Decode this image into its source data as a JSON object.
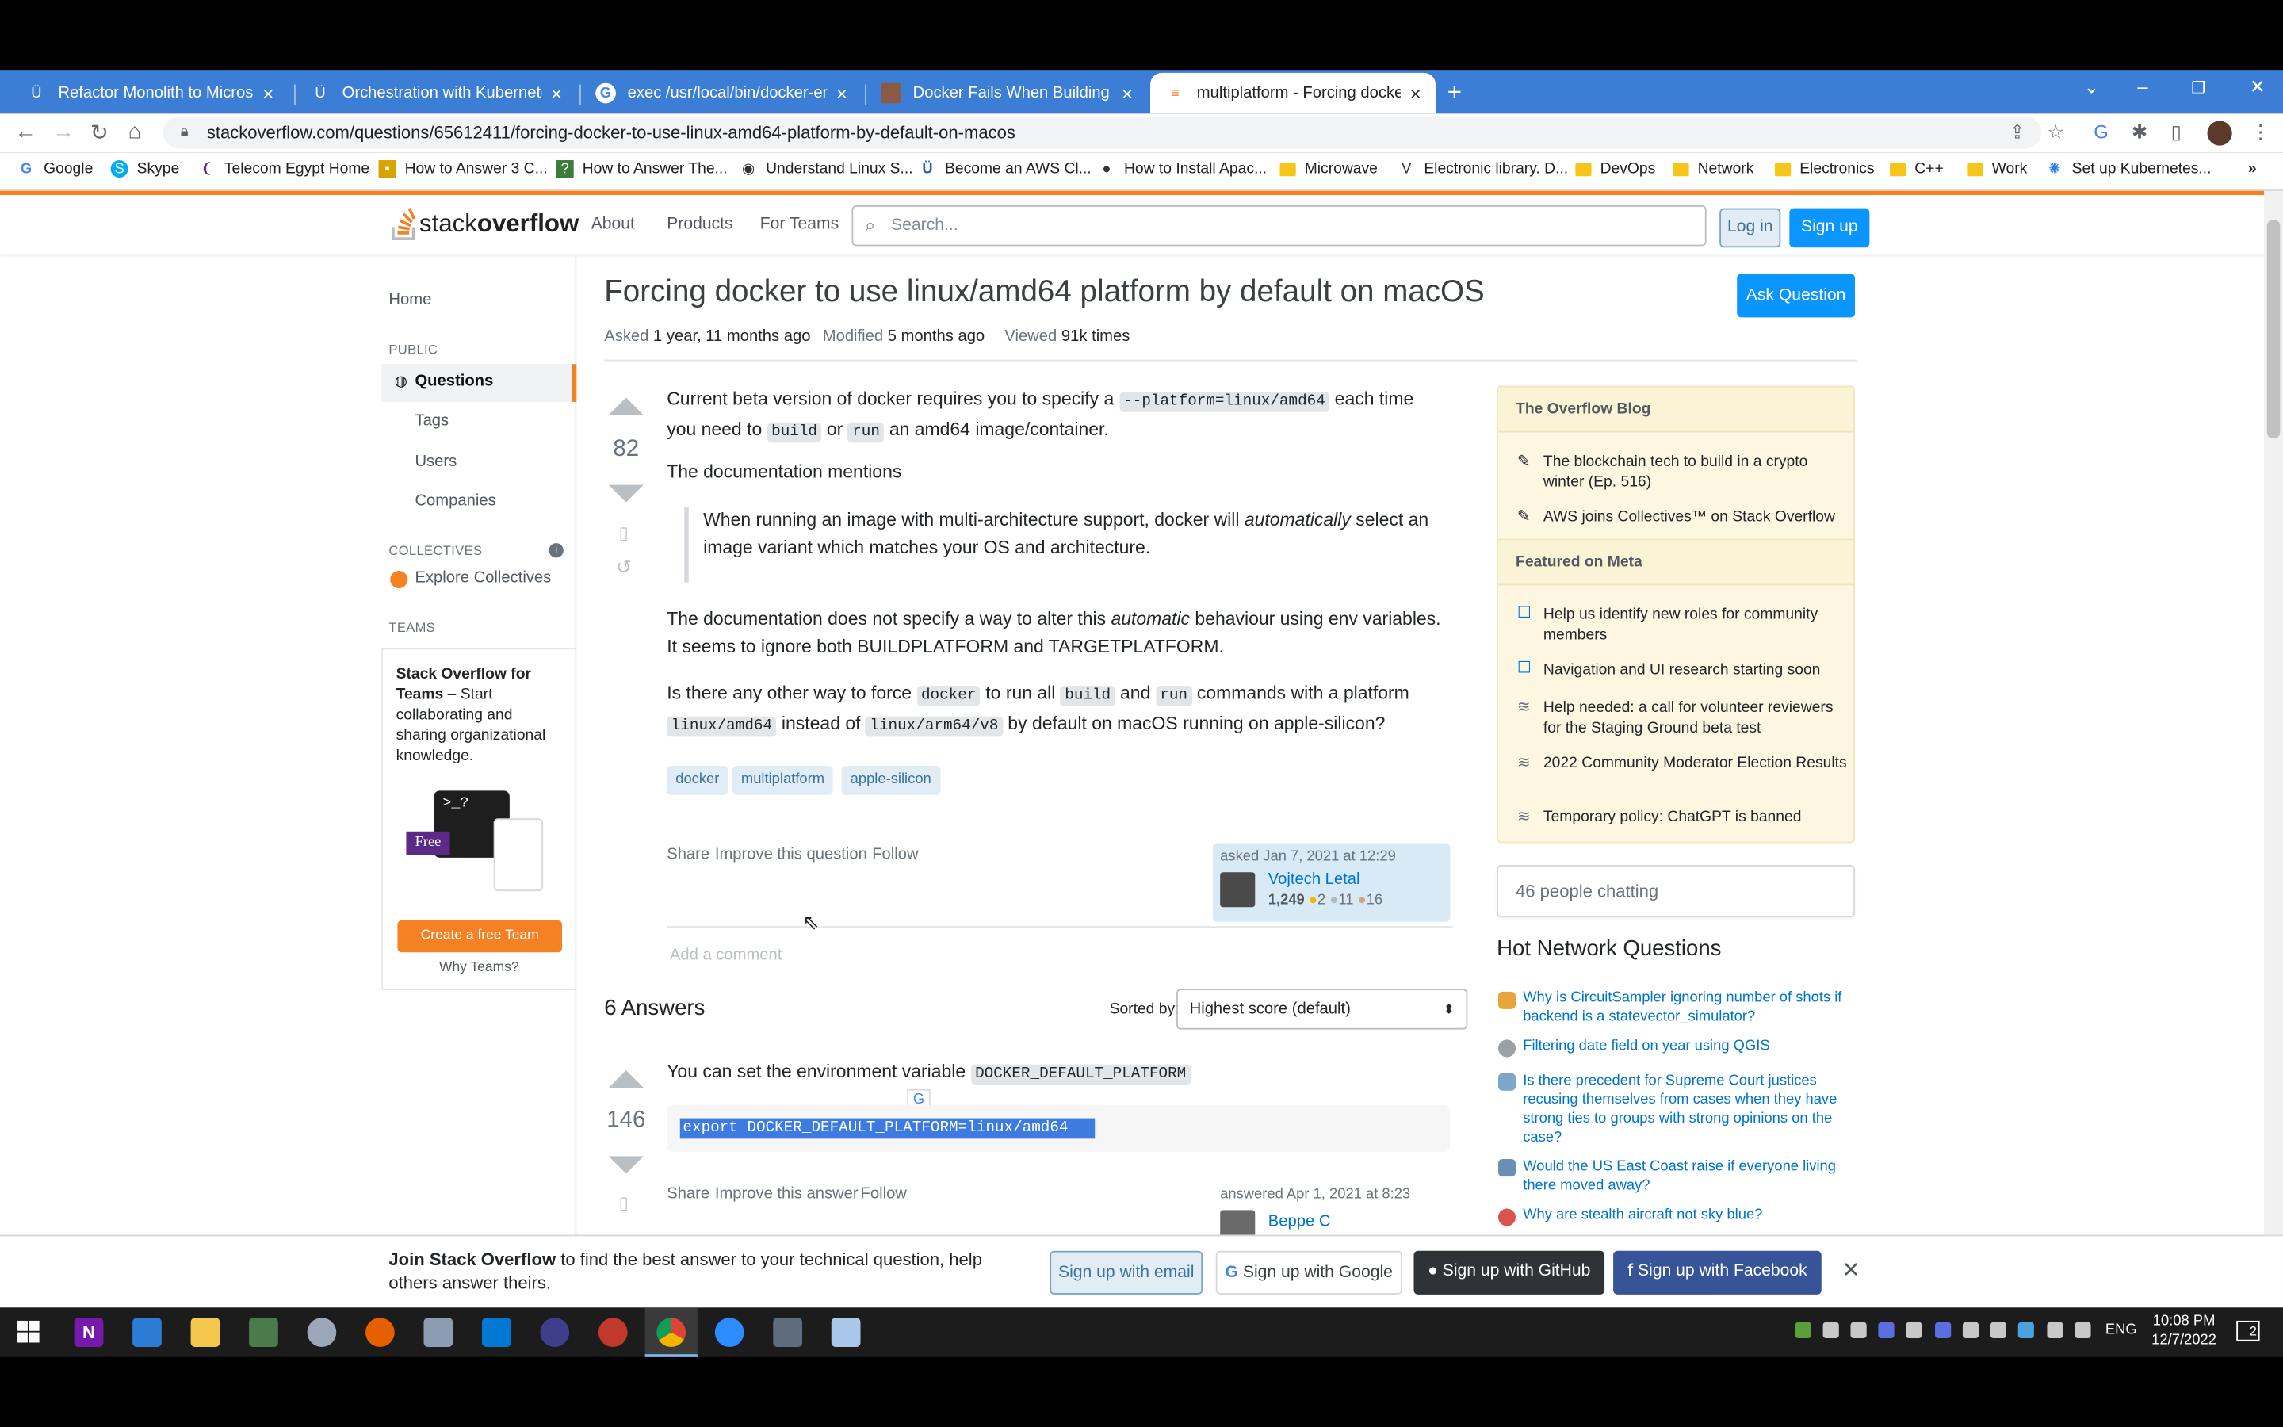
{
  "browser": {
    "tabs": [
      {
        "title": "Refactor Monolith to Microservic"
      },
      {
        "title": "Orchestration with Kubernetes"
      },
      {
        "title": "exec /usr/local/bin/docker-entry"
      },
      {
        "title": "Docker Fails When Building on M"
      },
      {
        "title": "multiplatform - Forcing docker to"
      }
    ],
    "new_tab": "+",
    "url": "stackoverflow.com/questions/65612411/forcing-docker-to-use-linux-amd64-platform-by-default-on-macos",
    "bookmarks": [
      "Google",
      "Skype",
      "Telecom Egypt Home",
      "How to Answer 3 C...",
      "How to Answer The...",
      "Understand Linux S...",
      "Become an AWS Cl...",
      "How to Install Apac...",
      "Microwave",
      "Electronic library. D...",
      "DevOps",
      "Network",
      "Electronics",
      "C++",
      "Work",
      "Set up Kubernetes..."
    ],
    "more_bookmarks": "»"
  },
  "so": {
    "logo_light": "stack",
    "logo_bold": "overflow",
    "nav": [
      "About",
      "Products",
      "For Teams"
    ],
    "search_placeholder": "Search...",
    "login": "Log in",
    "signup": "Sign up",
    "sidebar": {
      "home": "Home",
      "public": "PUBLIC",
      "questions": "Questions",
      "tags": "Tags",
      "users": "Users",
      "companies": "Companies",
      "collectives": "COLLECTIVES",
      "explore": "Explore Collectives",
      "teams": "TEAMS",
      "teams_title": "Stack Overflow for Teams",
      "teams_text": " – Start collaborating and sharing organizational knowledge.",
      "free": "Free",
      "create_team": "Create a free Team",
      "why_teams": "Why Teams?"
    },
    "question": {
      "title": "Forcing docker to use linux/amd64 platform by default on macOS",
      "asked_label": "Asked",
      "asked": "1 year, 11 months ago",
      "modified_label": "Modified",
      "modified": "5 months ago",
      "viewed_label": "Viewed",
      "viewed": "91k times",
      "ask_button": "Ask Question",
      "score": "82",
      "p1a": "Current beta version of docker requires you to specify a ",
      "p1code1": "--platform=linux/amd64",
      "p1b": " each time you need to ",
      "p1code2": "build",
      "p1c": " or ",
      "p1code3": "run",
      "p1d": " an amd64 image/container.",
      "p2": "The documentation mentions",
      "quote_a": "When running an image with multi-architecture support, docker will ",
      "quote_em": "automatically",
      "quote_b": " select an image variant which matches your OS and architecture.",
      "p3a": "The documentation does not specify a way to alter this ",
      "p3em": "automatic",
      "p3b": " behaviour using env variables. It seems to ignore both BUILDPLATFORM and TARGETPLATFORM.",
      "p4a": "Is there any other way to force ",
      "p4code1": "docker",
      "p4b": " to run all ",
      "p4code2": "build",
      "p4c": " and ",
      "p4code3": "run",
      "p4d": " commands with a platform ",
      "p4code4": "linux/amd64",
      "p4e": " instead of ",
      "p4code5": "linux/arm64/v8",
      "p4f": " by default on macOS running on apple-silicon?",
      "tags": [
        "docker",
        "multiplatform",
        "apple-silicon"
      ],
      "share": "Share",
      "improve": "Improve this question",
      "follow": "Follow",
      "asked_on": "asked Jan 7, 2021 at 12:29",
      "author": "Vojtech Letal",
      "rep": "1,249",
      "gold": "2",
      "silver": "11",
      "bronze": "16",
      "add_comment": "Add a comment"
    },
    "answers": {
      "heading": "6 Answers",
      "sorted_by": "Sorted by:",
      "sort_value": "Highest score (default)",
      "score": "146",
      "text": "You can set the environment variable ",
      "code": "DOCKER_DEFAULT_PLATFORM",
      "codeblock": "export DOCKER_DEFAULT_PLATFORM=linux/amd64",
      "share": "Share",
      "improve": "Improve this answer",
      "follow": "Follow",
      "answered_on": "answered Apr 1, 2021 at 8:23",
      "author": "Beppe C"
    },
    "blog": {
      "heading": "The Overflow Blog",
      "items": [
        "The blockchain tech to build in a crypto winter (Ep. 516)",
        "AWS joins Collectives™ on Stack Overflow"
      ],
      "meta_heading": "Featured on Meta",
      "meta_items": [
        "Help us identify new roles for community members",
        "Navigation and UI research starting soon",
        "Help needed: a call for volunteer reviewers for the Staging Ground beta test",
        "2022 Community Moderator Election Results",
        "Temporary policy: ChatGPT is banned"
      ]
    },
    "chat": "46 people chatting",
    "hnq": {
      "heading": "Hot Network Questions",
      "items": [
        "Why is CircuitSampler ignoring number of shots if backend is a statevector_simulator?",
        "Filtering date field on year using QGIS",
        "Is there precedent for Supreme Court justices recusing themselves from cases when they have strong ties to groups with strong opinions on the case?",
        "Would the US East Coast raise if everyone living there moved away?",
        "Why are stealth aircraft not sky blue?"
      ]
    },
    "signupbar": {
      "bold": "Join Stack Overflow",
      "text": " to find the best answer to your technical question, help others answer theirs.",
      "email": "Sign up with email",
      "google": "Sign up with Google",
      "github": "Sign up with GitHub",
      "facebook": "Sign up with Facebook"
    }
  },
  "taskbar": {
    "lang": "ENG",
    "time": "10:08 PM",
    "date": "12/7/2022",
    "notifications": "2"
  },
  "colors": {
    "accent": "#f48225",
    "link": "#0074cc",
    "button": "#0a95ff",
    "tabbar": "#3c7dd6"
  }
}
